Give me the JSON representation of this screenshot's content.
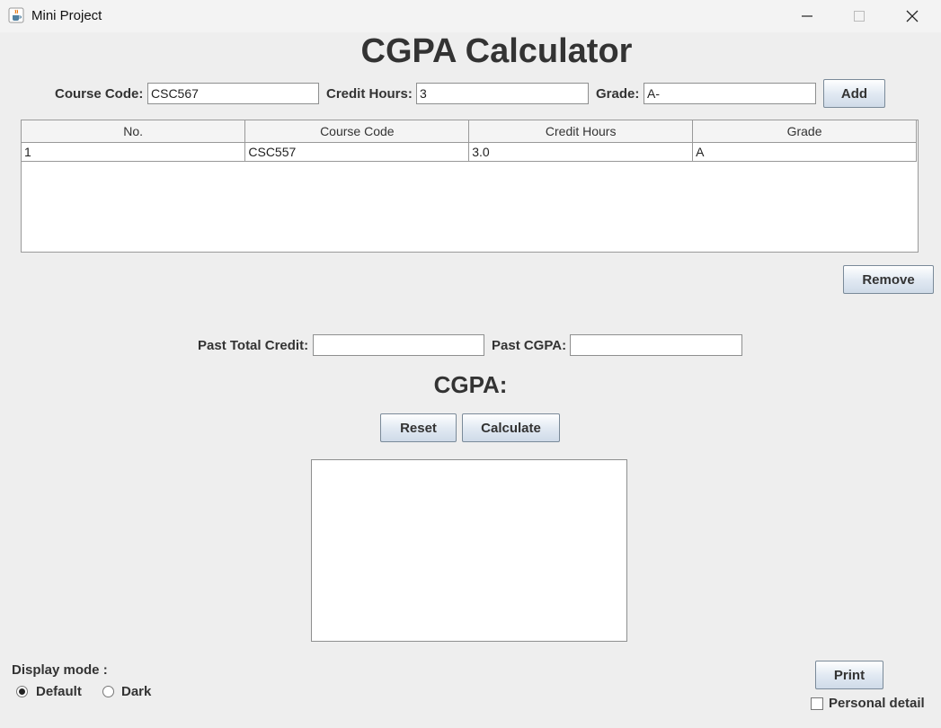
{
  "window": {
    "title": "Mini Project"
  },
  "heading": "CGPA Calculator",
  "course_code": {
    "label": "Course Code:",
    "value": "CSC567"
  },
  "credit_hours": {
    "label": "Credit Hours:",
    "value": "3"
  },
  "grade": {
    "label": "Grade:",
    "value": "A-"
  },
  "buttons": {
    "add": "Add",
    "remove": "Remove",
    "reset": "Reset",
    "calculate": "Calculate",
    "print": "Print"
  },
  "table": {
    "columns": [
      "No.",
      "Course Code",
      "Credit Hours",
      "Grade"
    ],
    "rows": [
      [
        "1",
        "CSC557",
        "3.0",
        "A"
      ]
    ]
  },
  "past_total_credit": {
    "label": "Past Total Credit:",
    "value": ""
  },
  "past_cgpa": {
    "label": "Past CGPA:",
    "value": ""
  },
  "cgpa_label": "CGPA:",
  "result_text": "",
  "display_mode": {
    "label": "Display mode :",
    "options": [
      "Default",
      "Dark"
    ],
    "selected": "Default"
  },
  "personal_detail": {
    "label": "Personal detail",
    "checked": false
  },
  "icons": {
    "app": "java-cup-icon",
    "minimize": "minimize-icon",
    "maximize": "maximize-icon",
    "close": "close-icon"
  }
}
